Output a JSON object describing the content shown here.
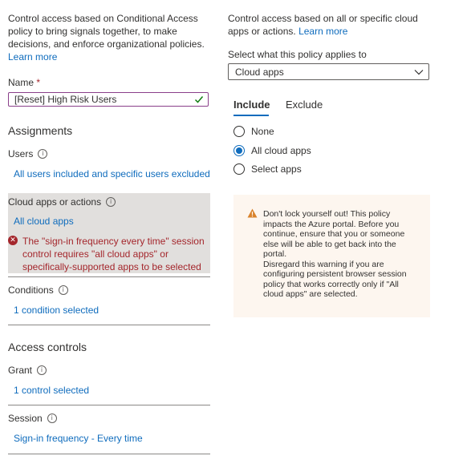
{
  "intro": {
    "text": "Control access based on Conditional Access policy to bring signals together, to make decisions, and enforce organizational policies.",
    "learn_more": "Learn more"
  },
  "name_field": {
    "label": "Name",
    "required_mark": "*",
    "value": "[Reset] High Risk Users"
  },
  "assignments": {
    "heading": "Assignments",
    "users": {
      "label": "Users",
      "value": "All users included and specific users excluded"
    },
    "cloud_apps": {
      "label": "Cloud apps or actions",
      "value": "All cloud apps",
      "error": "The \"sign-in frequency every time\" session control requires \"all cloud apps\" or specifically-supported apps to be selected"
    },
    "conditions": {
      "label": "Conditions",
      "value": "1 condition selected"
    }
  },
  "access_controls": {
    "heading": "Access controls",
    "grant": {
      "label": "Grant",
      "value": "1 control selected"
    },
    "session": {
      "label": "Session",
      "value": "Sign-in frequency - Every time"
    }
  },
  "right_panel": {
    "intro": "Control access based on all or specific cloud apps or actions.",
    "learn_more": "Learn more",
    "applies_label": "Select what this policy applies to",
    "applies_value": "Cloud apps",
    "tabs": {
      "include": "Include",
      "exclude": "Exclude"
    },
    "radios": {
      "none": "None",
      "all": "All cloud apps",
      "select": "Select apps"
    },
    "selected_radio": "All cloud apps",
    "warning": "Don't lock yourself out! This policy impacts the Azure portal. Before you continue, ensure that you or someone else will be able to get back into the portal.\nDisregard this warning if you are configuring persistent browser session policy that works correctly only if \"All cloud apps\" are selected."
  },
  "colors": {
    "link": "#0f6cbd",
    "error": "#a4262c",
    "warning_bg": "#fdf6ef",
    "selected_section_bg": "#e1dfdd",
    "warning_icon": "#d9822b"
  },
  "icons": {
    "info": "info-icon",
    "error": "error-icon",
    "warning": "warning-icon",
    "check": "check-icon",
    "chevron": "chevron-down-icon"
  }
}
